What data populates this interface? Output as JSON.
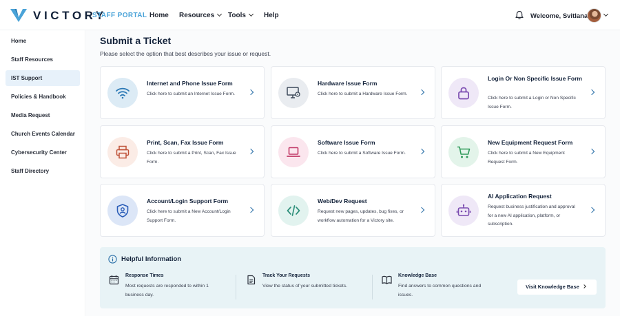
{
  "header": {
    "brand": "VICTORY",
    "portal": "STAFF PORTAL",
    "nav": [
      {
        "label": "Home",
        "dropdown": false
      },
      {
        "label": "Resources",
        "dropdown": true
      },
      {
        "label": "Tools",
        "dropdown": true
      },
      {
        "label": "Help",
        "dropdown": false
      }
    ],
    "welcome": "Welcome, Svitlana!"
  },
  "sidebar": {
    "items": [
      {
        "label": "Home",
        "active": false
      },
      {
        "label": "Staff Resources",
        "active": false
      },
      {
        "label": "IST Support",
        "active": true
      },
      {
        "label": "Policies & Handbook",
        "active": false
      },
      {
        "label": "Media Request",
        "active": false
      },
      {
        "label": "Church Events Calendar",
        "active": false
      },
      {
        "label": "Cybersecurity Center",
        "active": false
      },
      {
        "label": "Staff Directory",
        "active": false
      }
    ]
  },
  "main": {
    "title": "Submit a Ticket",
    "subtitle": "Please select the option that best describes your issue or request.",
    "cards": [
      {
        "title": "Internet and Phone Issue Form",
        "desc": "Click here to submit an Internet Issue Form.",
        "icon": "wifi-icon",
        "color": "#dcebf5",
        "fg": "#2a78b5"
      },
      {
        "title": "Hardware Issue Form",
        "desc": "Click here to submit a Hardware Issue Form.",
        "icon": "monitor-gear-icon",
        "color": "#e9ecf0",
        "fg": "#3d4a5a"
      },
      {
        "title": "Login Or Non Specific Issue Form",
        "desc": "Click here to submit a Login or Non Specific Issue Form.",
        "icon": "lock-icon",
        "color": "#efe8f7",
        "fg": "#7a4bb0"
      },
      {
        "title": "Print, Scan, Fax Issue Form",
        "desc": "Click here to submit a Print, Scan, Fax Issue Form.",
        "icon": "printer-icon",
        "color": "#fbece6",
        "fg": "#c0533a"
      },
      {
        "title": "Software Issue Form",
        "desc": "Click here to submit a Software Issue Form.",
        "icon": "laptop-icon",
        "color": "#fbe6ee",
        "fg": "#c23a68"
      },
      {
        "title": "New Equipment Request Form",
        "desc": "Click here to submit a New Equipment Request Form.",
        "icon": "cart-icon",
        "color": "#e3f4ea",
        "fg": "#2f9a5a"
      },
      {
        "title": "Account/Login Support Form",
        "desc": "Click here to submit a New Account/Login Support Form.",
        "icon": "shield-user-icon",
        "color": "#dce6f7",
        "fg": "#2a5db8"
      },
      {
        "title": "Web/Dev Request",
        "desc": "Request new pages, updates, bug fixes, or workflow automation for a Victory site.",
        "icon": "code-icon",
        "color": "#e2f3ef",
        "fg": "#2d8f7a"
      },
      {
        "title": "AI Application Request",
        "desc": "Request business justification and approval for a new AI application, platform, or subscription.",
        "icon": "robot-icon",
        "color": "#efe8f7",
        "fg": "#7a4bb0"
      }
    ]
  },
  "helpful": {
    "title": "Helpful Information",
    "items": [
      {
        "title": "Response Times",
        "desc": "Most requests are responded to within 1 business day.",
        "icon": "calendar-icon"
      },
      {
        "title": "Track Your Requests",
        "desc": "View the status of your submitted tickets.",
        "icon": "document-icon"
      },
      {
        "title": "Knowledge Base",
        "desc": "Find answers to common questions and issues.",
        "icon": "book-icon"
      }
    ],
    "button": "Visit Knowledge Base"
  }
}
